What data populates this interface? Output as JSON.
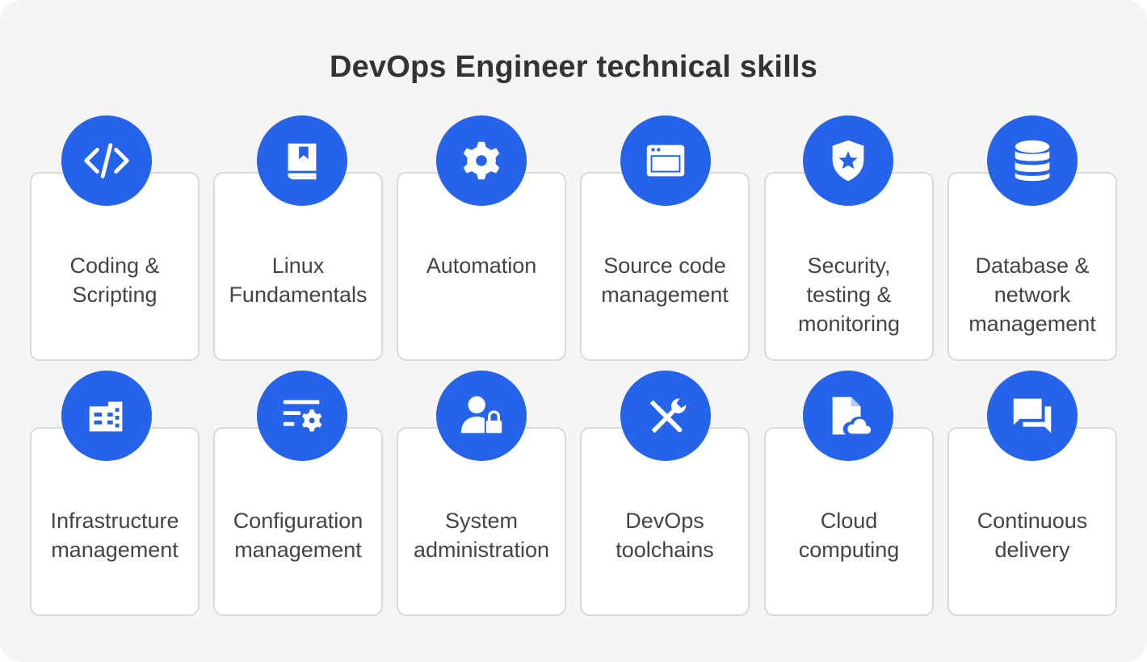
{
  "title": "DevOps Engineer technical skills",
  "colors": {
    "accent": "#2563eb",
    "background": "#f5f5f5",
    "card": "#ffffff",
    "text": "#444444"
  },
  "skills": [
    {
      "label": "Coding &\nScripting",
      "icon": "code-icon"
    },
    {
      "label": "Linux\nFundamentals",
      "icon": "book-icon"
    },
    {
      "label": "Automation",
      "icon": "gear-icon"
    },
    {
      "label": "Source code\nmanagement",
      "icon": "browser-window-icon"
    },
    {
      "label": "Security,\ntesting &\nmonitoring",
      "icon": "shield-star-icon"
    },
    {
      "label": "Database &\nnetwork\nmanagement",
      "icon": "database-icon"
    },
    {
      "label": "Infrastructure\nmanagement",
      "icon": "buildings-icon"
    },
    {
      "label": "Configuration\nmanagement",
      "icon": "settings-list-icon"
    },
    {
      "label": "System\nadministration",
      "icon": "admin-lock-icon"
    },
    {
      "label": "DevOps\ntoolchains",
      "icon": "tools-icon"
    },
    {
      "label": "Cloud\ncomputing",
      "icon": "cloud-file-icon"
    },
    {
      "label": "Continuous\ndelivery",
      "icon": "chat-bubbles-icon"
    }
  ]
}
